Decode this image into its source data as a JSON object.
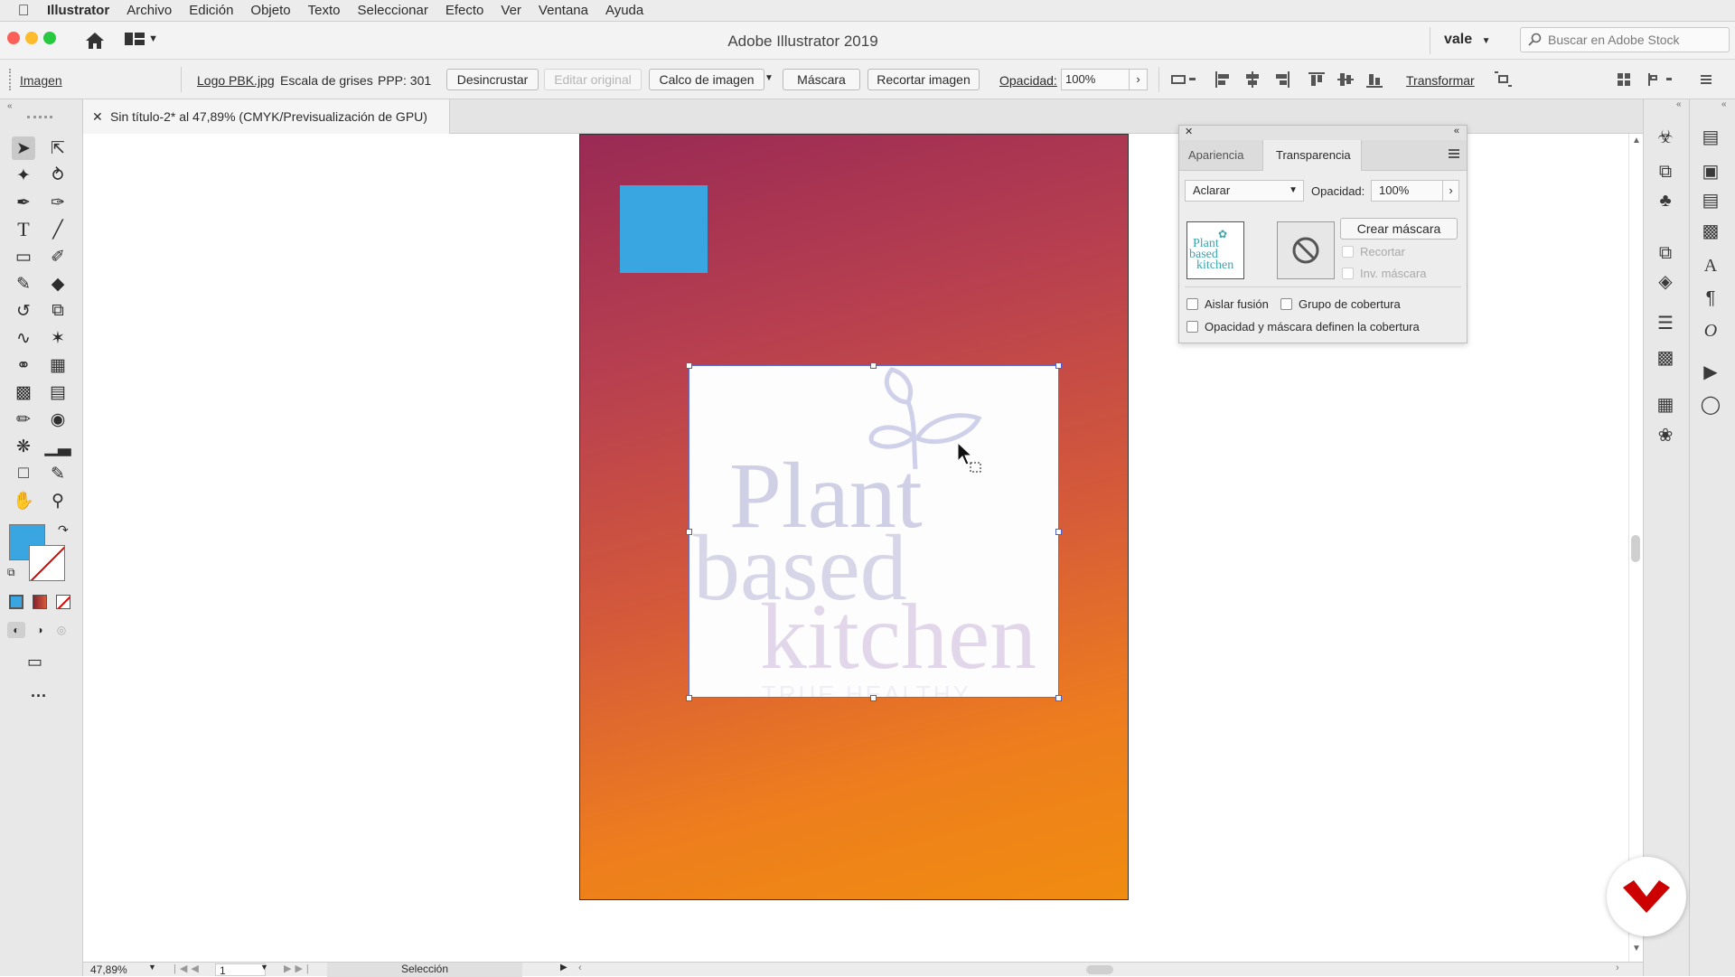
{
  "menubar": {
    "app": "Illustrator",
    "items": [
      "Archivo",
      "Edición",
      "Objeto",
      "Texto",
      "Seleccionar",
      "Efecto",
      "Ver",
      "Ventana",
      "Ayuda"
    ]
  },
  "titlebar": {
    "title": "Adobe Illustrator 2019",
    "user": "vale",
    "search_placeholder": "Buscar en Adobe Stock"
  },
  "control": {
    "type_label": "Imagen",
    "file_name": "Logo PBK.jpg",
    "color_mode": "Escala de grises",
    "ppi": "PPP: 301",
    "unembed": "Desincrustar",
    "edit_original": "Editar original",
    "image_trace": "Calco de imagen",
    "mask": "Máscara",
    "crop": "Recortar imagen",
    "opacity_label": "Opacidad:",
    "opacity_value": "100%",
    "transform": "Transformar"
  },
  "document": {
    "tab_title": "Sin título-2* al 47,89% (CMYK/Previsualización de GPU)"
  },
  "artwork": {
    "logo_line1": "Plant",
    "logo_line2": "based",
    "logo_line3": "kitchen",
    "tagline": "TRUE HEALTHY SIMPLE",
    "gradient_start": "#9a2a55",
    "gradient_end": "#f08c10",
    "square_color": "#39a5e1"
  },
  "panel": {
    "tab_appearance": "Apariencia",
    "tab_transparency": "Transparencia",
    "blend_mode": "Aclarar",
    "opacity_label": "Opacidad:",
    "opacity_value": "100%",
    "thumb_line1": "Plant",
    "thumb_line2": "based",
    "thumb_line3": "kitchen",
    "make_mask": "Crear máscara",
    "clip": "Recortar",
    "invert_mask": "Inv. máscara",
    "isolate_blending": "Aislar fusión",
    "knockout_group": "Grupo de cobertura",
    "opacity_mask_knockout": "Opacidad y máscara definen la cobertura"
  },
  "status": {
    "zoom": "47,89%",
    "artboard": "1",
    "tool": "Selección"
  },
  "colors": {
    "fill": "#39a5e1",
    "accent": "#cc0000"
  }
}
